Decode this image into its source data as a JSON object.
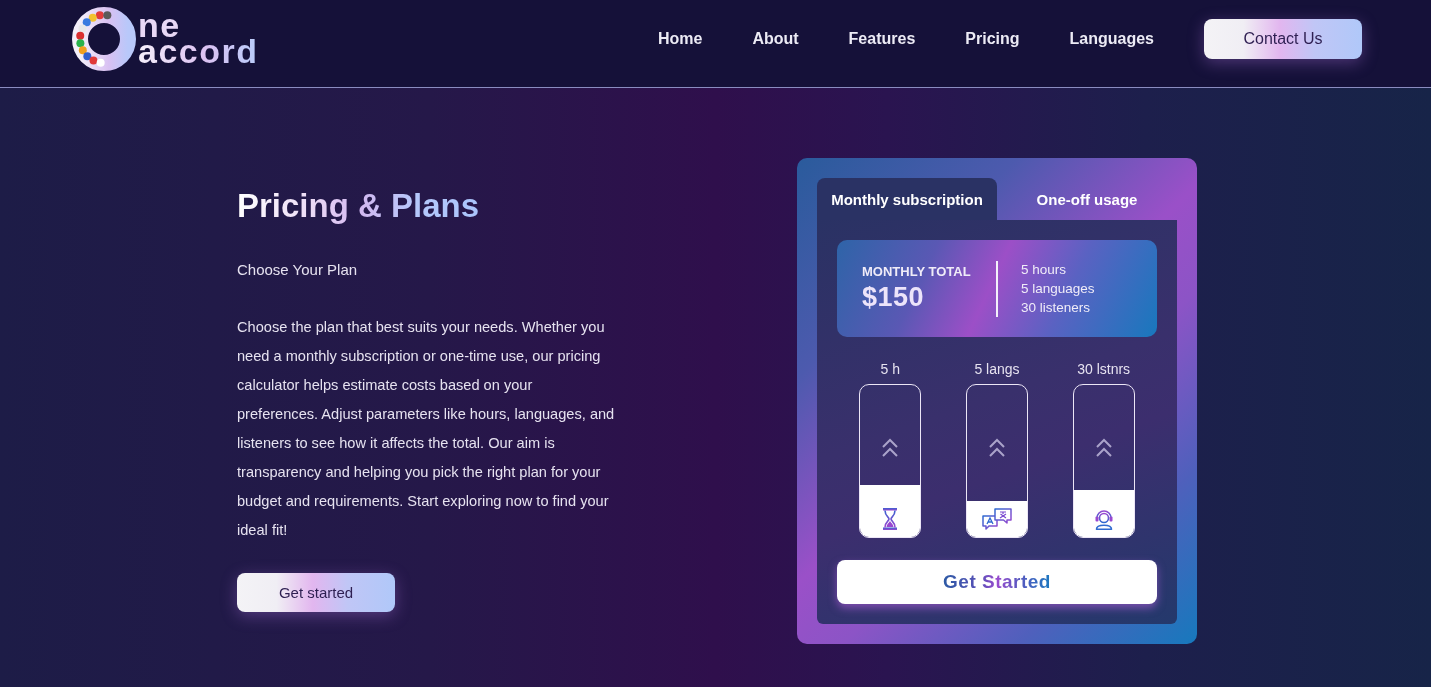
{
  "header": {
    "logo": {
      "line_1": "ne",
      "line_2": "accord"
    },
    "nav": [
      {
        "label": "Home"
      },
      {
        "label": "About"
      },
      {
        "label": "Features"
      },
      {
        "label": "Pricing"
      },
      {
        "label": "Languages"
      }
    ],
    "cta": "Contact Us"
  },
  "intro": {
    "title": "Pricing & Plans",
    "subtitle": "Choose Your Plan",
    "description": "Choose the plan that best suits your needs. Whether you need a monthly subscription or one-time use, our pricing calculator helps estimate costs based on your preferences. Adjust parameters like hours, languages, and listeners to see how it affects the total. Our aim is transparency and helping you pick the right plan for your budget and requirements. Start exploring now to find your ideal fit!",
    "button": "Get started"
  },
  "calculator": {
    "tabs": [
      {
        "label": "Monthly subscription",
        "selected": true
      },
      {
        "label": "One-off usage",
        "selected": false
      }
    ],
    "summary": {
      "label": "MONTHLY TOTAL",
      "amount": "$150",
      "details": [
        "5 hours",
        "5 languages",
        "30 listeners"
      ]
    },
    "sliders": [
      {
        "kind": "hours",
        "label": "5 h",
        "level": 0.34
      },
      {
        "kind": "languages",
        "label": "5 langs",
        "level": 0.24
      },
      {
        "kind": "listeners",
        "label": "30 lstnrs",
        "level": 0.31
      }
    ],
    "button": "Get Started"
  }
}
